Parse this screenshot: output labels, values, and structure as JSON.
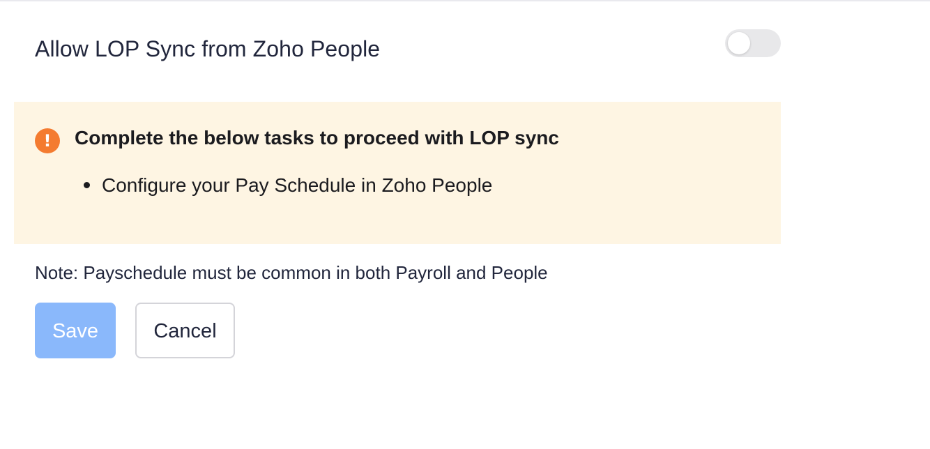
{
  "setting": {
    "title": "Allow LOP Sync from Zoho People",
    "toggle_enabled": false
  },
  "warning": {
    "icon": "exclamation-circle-icon",
    "icon_glyph": "!",
    "heading": "Complete the below tasks to proceed with LOP sync",
    "tasks": [
      "Configure your Pay Schedule in Zoho People"
    ]
  },
  "note": "Note: Payschedule must be common in both Payroll and People",
  "actions": {
    "save_label": "Save",
    "cancel_label": "Cancel"
  },
  "colors": {
    "warning_bg": "#fef5e3",
    "warning_icon": "#f47b30",
    "save_button": "#8ab8fb",
    "toggle_off": "#e8e8ea"
  }
}
